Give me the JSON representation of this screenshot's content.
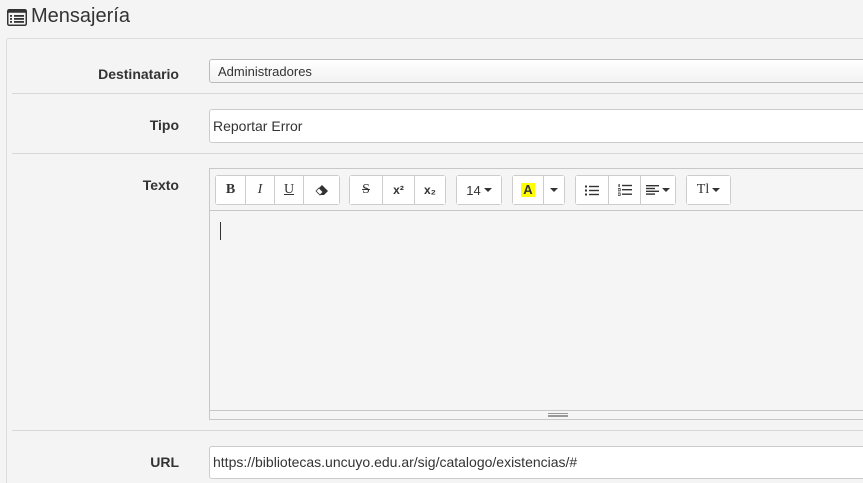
{
  "header": {
    "title": "Mensajería",
    "icon": "list-alt-icon"
  },
  "form": {
    "destinatario": {
      "label": "Destinatario",
      "value": "Administradores"
    },
    "tipo": {
      "label": "Tipo",
      "value": "Reportar Error"
    },
    "texto": {
      "label": "Texto",
      "toolbar": {
        "bold": "B",
        "italic": "I",
        "underline": "U",
        "strikethrough": "S",
        "superscript": "x²",
        "subscript": "x₂",
        "font_size": "14",
        "color_letter": "A",
        "highlight_color": "#ffff00",
        "font_family_label": "Tl"
      }
    },
    "url": {
      "label": "URL",
      "value": "https://bibliotecas.uncuyo.edu.ar/sig/catalogo/existencias/#"
    }
  }
}
